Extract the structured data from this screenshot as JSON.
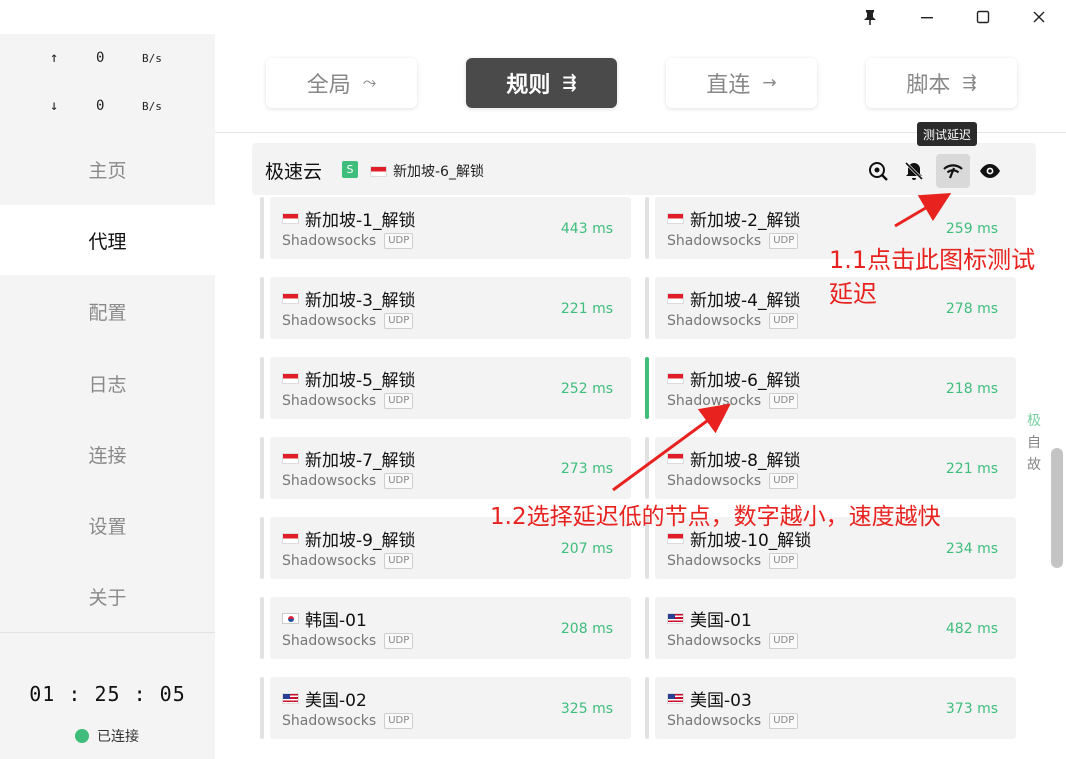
{
  "window": {
    "pin_icon": "pin-icon",
    "minimize_icon": "minimize-icon",
    "maximize_icon": "maximize-icon",
    "close_icon": "close-icon"
  },
  "sidebar": {
    "upload": {
      "arrow": "↑",
      "value": "0",
      "unit": "B/s"
    },
    "download": {
      "arrow": "↓",
      "value": "0",
      "unit": "B/s"
    },
    "items": [
      {
        "label": "主页"
      },
      {
        "label": "代理"
      },
      {
        "label": "配置"
      },
      {
        "label": "日志"
      },
      {
        "label": "连接"
      },
      {
        "label": "设置"
      },
      {
        "label": "关于"
      }
    ],
    "active_index": 1,
    "timer": "01 : 25 : 05",
    "status": "已连接",
    "status_color": "#3ebd7b"
  },
  "modes": [
    {
      "label": "全局",
      "icon": "⤳"
    },
    {
      "label": "规则",
      "icon": "⇶"
    },
    {
      "label": "直连",
      "icon": "→"
    },
    {
      "label": "脚本",
      "icon": "⇶"
    }
  ],
  "active_mode": 1,
  "group": {
    "name": "极速云",
    "badge": "S",
    "selected": "新加坡-6_解锁",
    "tooltip": "测试延迟"
  },
  "proxies": [
    {
      "name": "新加坡-1_解锁",
      "flag": "sg",
      "type": "Shadowsocks",
      "udp": "UDP",
      "delay": "443 ms"
    },
    {
      "name": "新加坡-2_解锁",
      "flag": "sg",
      "type": "Shadowsocks",
      "udp": "UDP",
      "delay": "259 ms"
    },
    {
      "name": "新加坡-3_解锁",
      "flag": "sg",
      "type": "Shadowsocks",
      "udp": "UDP",
      "delay": "221 ms"
    },
    {
      "name": "新加坡-4_解锁",
      "flag": "sg",
      "type": "Shadowsocks",
      "udp": "UDP",
      "delay": "278 ms"
    },
    {
      "name": "新加坡-5_解锁",
      "flag": "sg",
      "type": "Shadowsocks",
      "udp": "UDP",
      "delay": "252 ms"
    },
    {
      "name": "新加坡-6_解锁",
      "flag": "sg",
      "type": "Shadowsocks",
      "udp": "UDP",
      "delay": "218 ms"
    },
    {
      "name": "新加坡-7_解锁",
      "flag": "sg",
      "type": "Shadowsocks",
      "udp": "UDP",
      "delay": "273 ms"
    },
    {
      "name": "新加坡-8_解锁",
      "flag": "sg",
      "type": "Shadowsocks",
      "udp": "UDP",
      "delay": "221 ms"
    },
    {
      "name": "新加坡-9_解锁",
      "flag": "sg",
      "type": "Shadowsocks",
      "udp": "UDP",
      "delay": "207 ms"
    },
    {
      "name": "新加坡-10_解锁",
      "flag": "sg",
      "type": "Shadowsocks",
      "udp": "UDP",
      "delay": "234 ms"
    },
    {
      "name": "韩国-01",
      "flag": "kr",
      "type": "Shadowsocks",
      "udp": "UDP",
      "delay": "208 ms"
    },
    {
      "name": "美国-01",
      "flag": "us",
      "type": "Shadowsocks",
      "udp": "UDP",
      "delay": "482 ms"
    },
    {
      "name": "美国-02",
      "flag": "us",
      "type": "Shadowsocks",
      "udp": "UDP",
      "delay": "325 ms"
    },
    {
      "name": "美国-03",
      "flag": "us",
      "type": "Shadowsocks",
      "udp": "UDP",
      "delay": "373 ms"
    }
  ],
  "selected_proxy_index": 5,
  "side_letters": [
    "极",
    "自",
    "故"
  ],
  "annotations": {
    "note1_line1": "1.1点击此图标测试",
    "note1_line2": "延迟",
    "note2": "1.2选择延迟低的节点，数字越小，速度越快",
    "color": "#e8231f"
  },
  "colors": {
    "accent_green": "#3ebd7b",
    "active_mode_bg": "#4a4a4a"
  }
}
